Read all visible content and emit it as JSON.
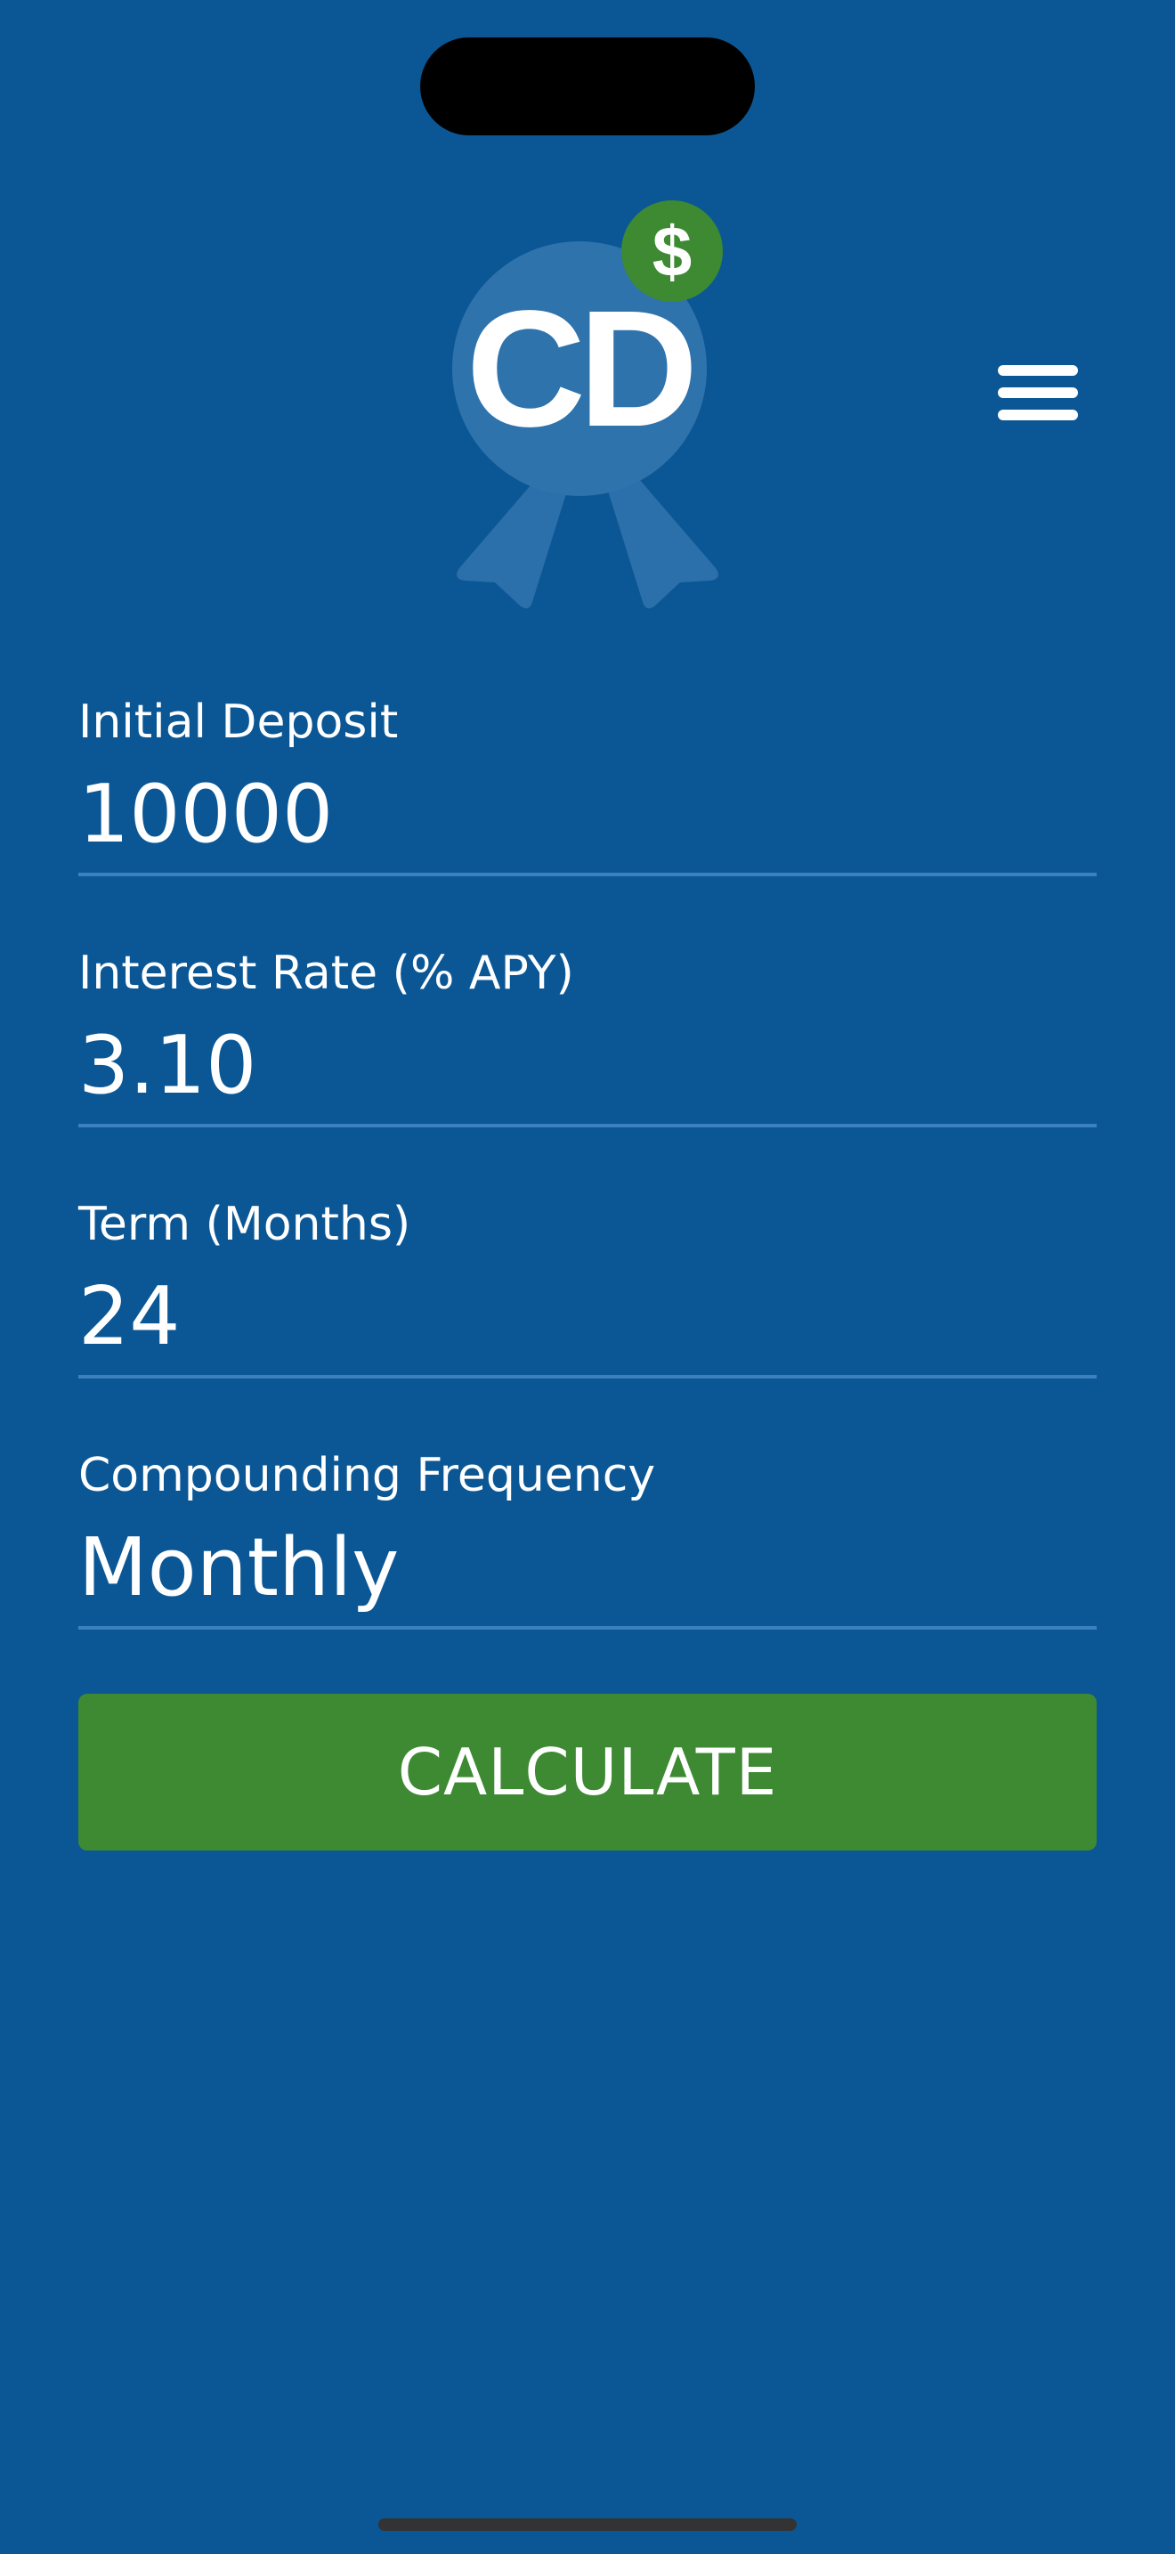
{
  "app": {
    "logo_text": "CD",
    "logo_badge_symbol": "$",
    "menu_icon": "hamburger-menu-icon"
  },
  "form": {
    "fields": [
      {
        "label": "Initial Deposit",
        "value": "10000"
      },
      {
        "label": "Interest Rate (% APY)",
        "value": "3.10"
      },
      {
        "label": "Term (Months)",
        "value": "24"
      },
      {
        "label": "Compounding Frequency",
        "value": "Monthly"
      }
    ],
    "submit_label": "CALCULATE"
  },
  "colors": {
    "background": "#0b5795",
    "field_underline": "#3a81bd",
    "button": "#3d8a33",
    "badge": "#3d8a33",
    "logo_medal": "#2f73ad"
  }
}
